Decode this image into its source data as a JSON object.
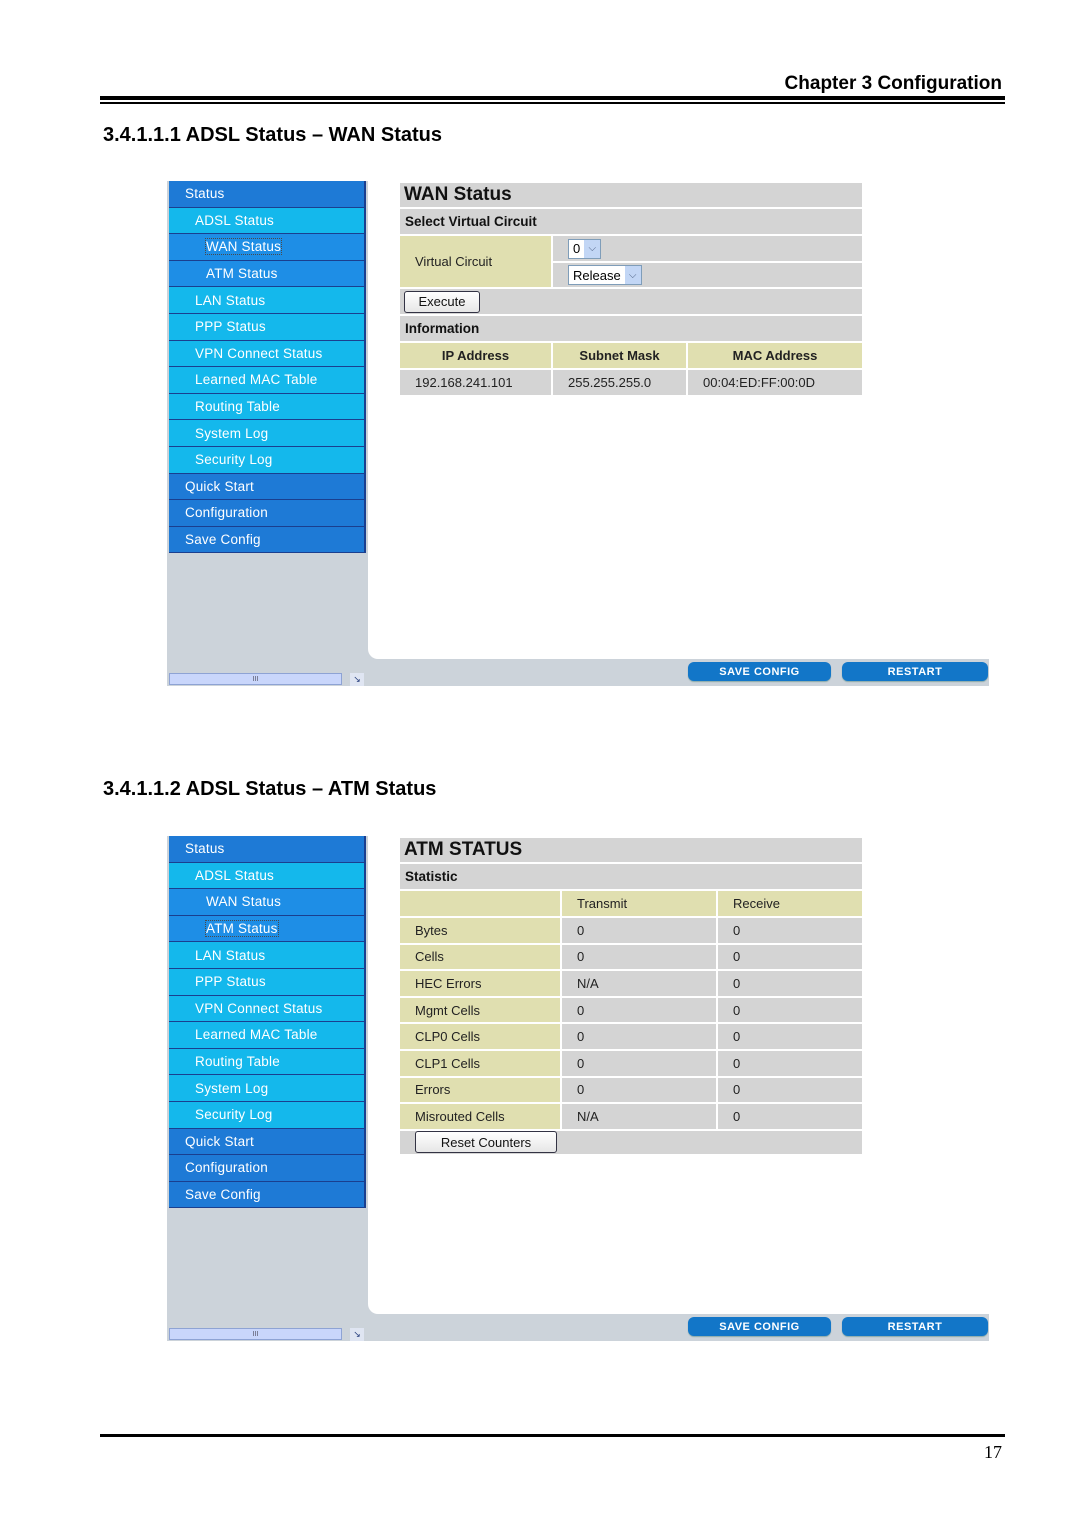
{
  "document": {
    "chapter_header": "Chapter 3 Configuration",
    "page_number": "17",
    "sections": [
      {
        "heading": "3.4.1.1.1 ADSL Status – WAN Status"
      },
      {
        "heading": "3.4.1.1.2 ADSL Status – ATM Status"
      }
    ]
  },
  "sidebar_items": [
    {
      "label": "Status",
      "level": 0
    },
    {
      "label": "ADSL Status",
      "level": 1
    },
    {
      "label": "WAN Status",
      "level": 2
    },
    {
      "label": "ATM Status",
      "level": 2
    },
    {
      "label": "LAN Status",
      "level": 1
    },
    {
      "label": "PPP Status",
      "level": 1
    },
    {
      "label": "VPN Connect Status",
      "level": 1
    },
    {
      "label": "Learned MAC Table",
      "level": 1
    },
    {
      "label": "Routing Table",
      "level": 1
    },
    {
      "label": "System Log",
      "level": 1
    },
    {
      "label": "Security Log",
      "level": 1
    },
    {
      "label": "Quick Start",
      "level": 0
    },
    {
      "label": "Configuration",
      "level": 0
    },
    {
      "label": "Save Config",
      "level": 0
    }
  ],
  "wan": {
    "sidebar_selected": "WAN Status",
    "title": "WAN Status",
    "select_section": "Select Virtual Circuit",
    "vc_label": "Virtual Circuit",
    "vc_value": "0",
    "action_value": "Release",
    "execute_label": "Execute",
    "info_section": "Information",
    "columns": [
      "IP Address",
      "Subnet Mask",
      "MAC Address"
    ],
    "row": [
      "192.168.241.101",
      "255.255.255.0",
      "00:04:ED:FF:00:0D"
    ]
  },
  "atm": {
    "sidebar_selected": "ATM Status",
    "title": "ATM STATUS",
    "section": "Statistic",
    "columns": [
      "",
      "Transmit",
      "Receive"
    ],
    "rows": [
      [
        "Bytes",
        "0",
        "0"
      ],
      [
        "Cells",
        "0",
        "0"
      ],
      [
        "HEC Errors",
        "N/A",
        "0"
      ],
      [
        "Mgmt Cells",
        "0",
        "0"
      ],
      [
        "CLP0 Cells",
        "0",
        "0"
      ],
      [
        "CLP1 Cells",
        "0",
        "0"
      ],
      [
        "Errors",
        "0",
        "0"
      ],
      [
        "Misrouted Cells",
        "N/A",
        "0"
      ]
    ],
    "reset_label": "Reset Counters"
  },
  "footer_buttons": {
    "save": "SAVE CONFIG",
    "restart": "RESTART"
  },
  "scrollbar_grip": "III",
  "colors": {
    "nav_dark": "#1e7ad6",
    "nav_light": "#14b8ec",
    "nav_sub": "#1e8ee6",
    "khaki": "#e0dfb0",
    "grey": "#d4d4d4",
    "button_blue": "#1276c8"
  }
}
